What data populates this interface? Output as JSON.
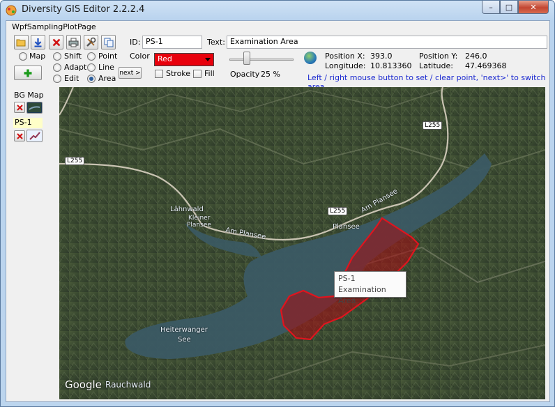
{
  "window": {
    "title": "Diversity GIS Editor 2.2.2.4",
    "min_label": "–",
    "max_label": "□",
    "close_label": "✕"
  },
  "page": {
    "label": "WpfSamplingPlotPage"
  },
  "toolbar": {
    "icons": [
      "open-icon",
      "save-icon",
      "delete-icon",
      "print-icon",
      "tools-icon",
      "copy-icon"
    ]
  },
  "form": {
    "id_label": "ID:",
    "id_value": "PS-1",
    "text_label": "Text:",
    "text_value": "Examination Area",
    "color_label": "Color",
    "color_value": "Red",
    "color_hex": "#e8000c",
    "stroke_label": "Stroke",
    "fill_label": "Fill",
    "opacity_label": "Opacity",
    "opacity_value": "25 %",
    "next_label": "next >"
  },
  "modes": {
    "map_label": "Map",
    "shift_label": "Shift",
    "adapt_label": "Adapt",
    "edit_label": "Edit",
    "point_label": "Point",
    "line_label": "Line",
    "area_label": "Area",
    "selected": "Area"
  },
  "position": {
    "x_label": "Position X:",
    "x_value": "393.0",
    "y_label": "Position Y:",
    "y_value": "246.0",
    "lon_label": "Longitude:",
    "lon_value": "10.813360",
    "lat_label": "Latitude:",
    "lat_value": "47.469368"
  },
  "hint": "Left / right mouse button to set / clear point, 'next>' to switch area",
  "sidebar": {
    "items": [
      {
        "label": "BG Map"
      },
      {
        "label": "PS-1"
      }
    ]
  },
  "map": {
    "labels": {
      "lahnwald": "Lähnwald",
      "kleiner": "Kleiner",
      "plansee_small": "Plansee",
      "am_plansee_1": "Am Plansee",
      "am_plansee_2": "Am Plansee",
      "plansee": "Plansee",
      "heiterwanger": "Heiterwanger",
      "see": "See",
      "rauchwald": "Rauchwald",
      "google": "Google",
      "road_l255_a": "L255",
      "road_l255_b": "L255",
      "road_l255_c": "L255"
    },
    "tooltip": {
      "line1": "PS-1",
      "line2": "Examination Area"
    },
    "polygon_color": "#c8141e"
  }
}
